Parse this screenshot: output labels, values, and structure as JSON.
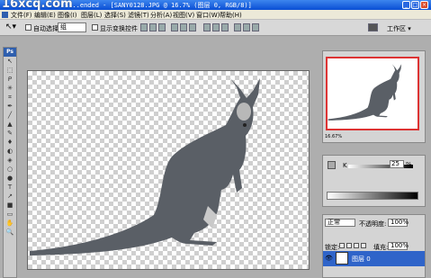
{
  "titlebar": {
    "watermark": "16xcq.com",
    "title": "Adobe Photoshop CS2 Extended - [SANY0128.JPG @ 16.7% (图层 0, RGB/8)]",
    "title_visible": "s...ended - [SANY0128.JPG @ 16.7% (图层 0, RGB/8)]",
    "minimize_label": "_",
    "maximize_label": "□",
    "close_label": "×"
  },
  "menubar": {
    "items": [
      "文件(F)",
      "编辑(E)",
      "图像(I)",
      "图层(L)",
      "选择(S)",
      "滤镜(T)",
      "分析(A)",
      "视图(V)",
      "窗口(W)",
      "帮助(H)"
    ]
  },
  "options": {
    "auto_select_label": "自动选择:",
    "auto_select_value": "组",
    "show_transform_label": "显示变换控件",
    "workspace_label": "工作区 ▾"
  },
  "tools": {
    "ps_logo": "Ps",
    "glyphs": [
      "↖",
      "⬚",
      "ᑭ",
      "✳",
      "⌗",
      "✒",
      "╱",
      "▲",
      "✎",
      "♦",
      "◐",
      "◈",
      "○",
      "●",
      "T",
      "↗",
      "■",
      "▭",
      "✋",
      "🔍"
    ]
  },
  "navigator": {
    "zoom": "16.67%"
  },
  "color": {
    "channel_label": "K",
    "k_value": "25",
    "percent_sign": "%",
    "k_level": 0.25
  },
  "layers": {
    "blend_mode": "正常",
    "opacity_label": "不透明度:",
    "opacity_value": "100%",
    "lock_label": "锁定:",
    "fill_label": "填充:",
    "fill_value": "100%",
    "layer_name": "图层 0",
    "eye": "👁"
  },
  "colors": {
    "titlebar": "#0a4fd4",
    "layer_selected": "#2f64c9",
    "nav_frame": "#dd3333"
  }
}
